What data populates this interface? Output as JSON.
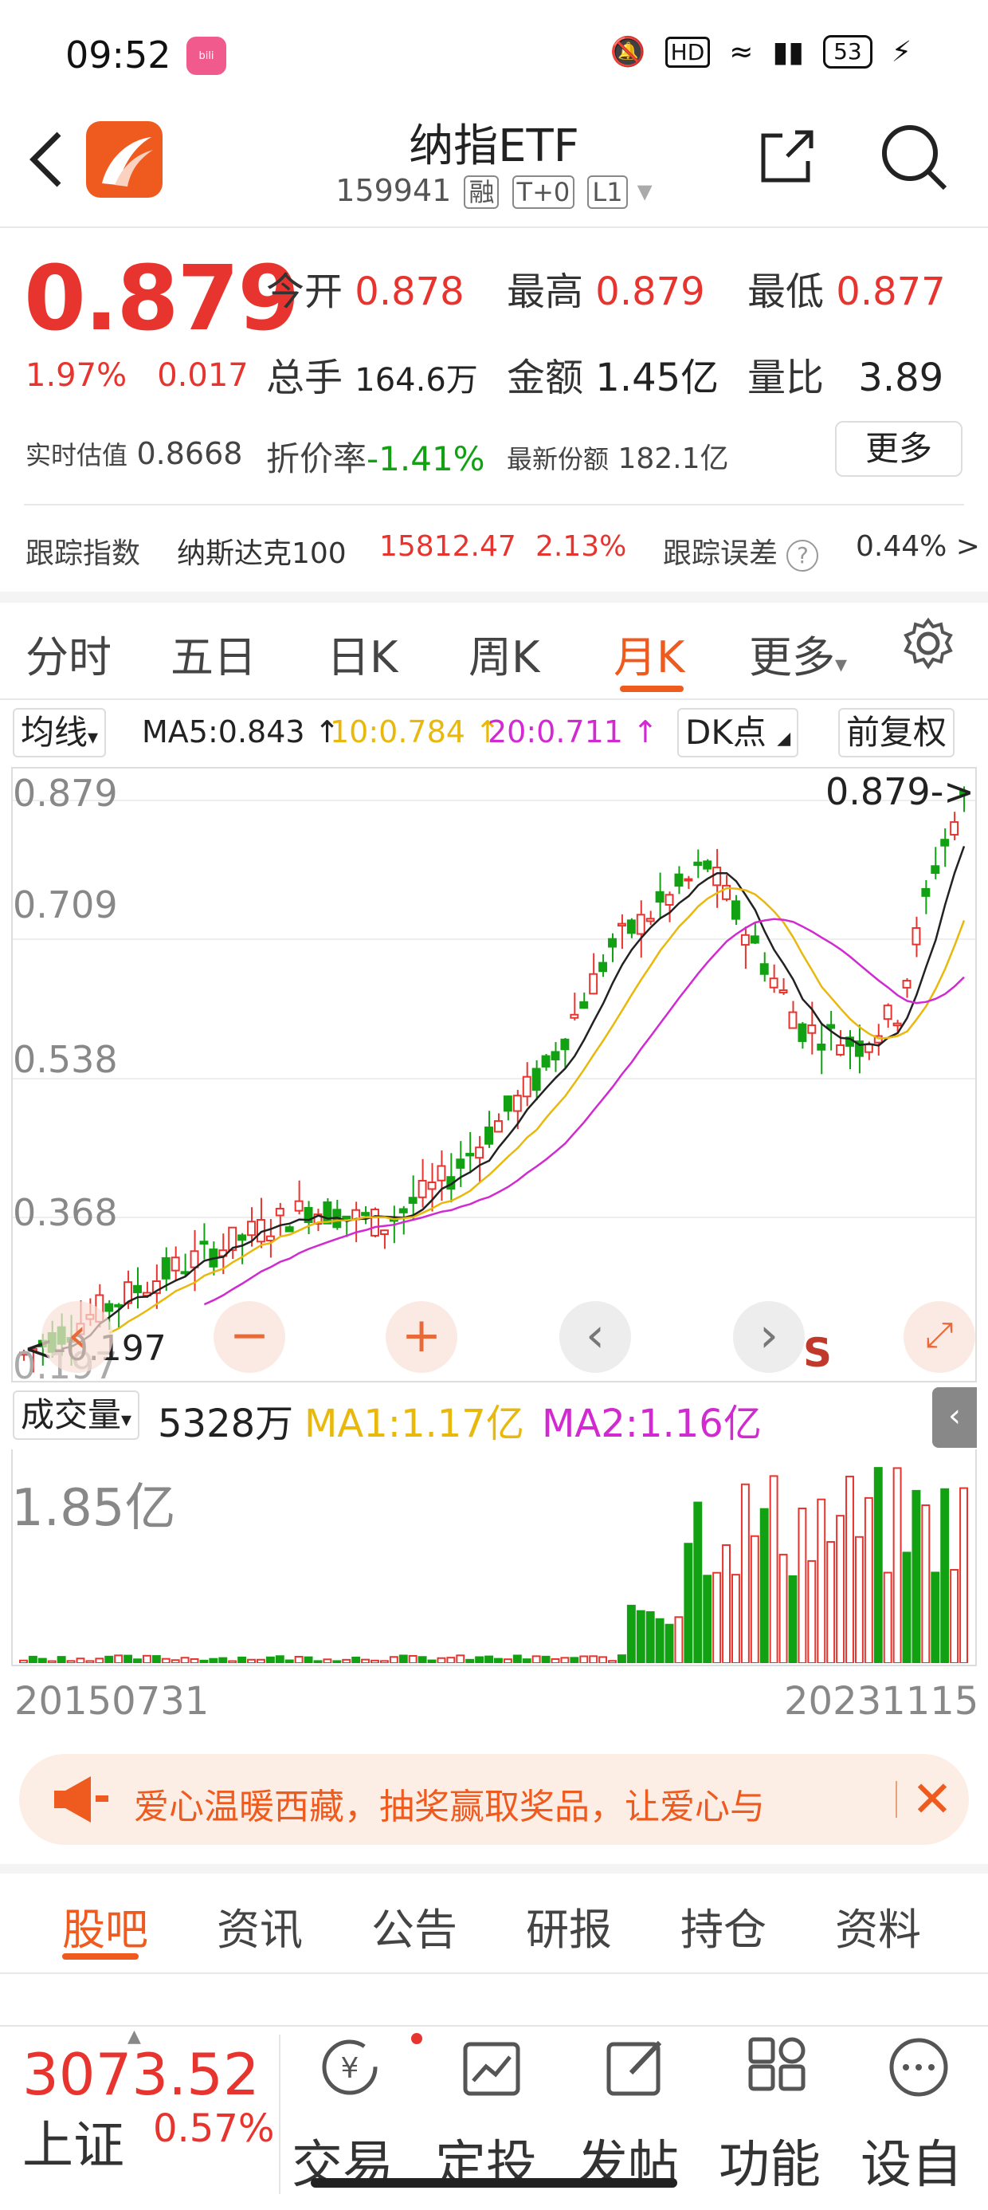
{
  "status": {
    "time": "09:52",
    "battery": "53"
  },
  "header": {
    "title": "纳指ETF",
    "code": "159941",
    "tags": [
      "融",
      "T+0",
      "L1"
    ]
  },
  "quote": {
    "price": "0.879",
    "change_pct": "1.97%",
    "change_amt": "0.017",
    "open_label": "今开",
    "open": "0.878",
    "high_label": "最高",
    "high": "0.879",
    "low_label": "最低",
    "low": "0.877",
    "volume_label": "总手",
    "volume": "164.6万",
    "amount_label": "金额",
    "amount": "1.45亿",
    "ratio_label": "量比",
    "ratio": "3.89",
    "iopv_label": "实时估值",
    "iopv": "0.8668",
    "discount_label": "折价率",
    "discount": "-1.41%",
    "shares_label": "最新份额",
    "shares": "182.1亿",
    "more": "更多"
  },
  "tracking": {
    "label": "跟踪指数",
    "index_name": "纳斯达克100",
    "index_value": "15812.47",
    "index_change": "2.13%",
    "error_label": "跟踪误差",
    "error_value": "0.44% >"
  },
  "tabs": [
    "分时",
    "五日",
    "日K",
    "周K",
    "月K",
    "更多"
  ],
  "chart_toolbar": {
    "ma_select": "均线",
    "ma5": "MA5:0.843",
    "ma10": "10:0.784",
    "ma20": "20:0.711",
    "dk": "DK点",
    "adjust": "前复权"
  },
  "kchart": {
    "y_labels": [
      "0.879",
      "0.709",
      "0.538",
      "0.368",
      "0.197"
    ],
    "last_price_marker": "0.879->",
    "low_marker": "<-0.197",
    "s_marker": "S"
  },
  "volume": {
    "select": "成交量",
    "value": "5328万",
    "ma1": "MA1:1.17亿",
    "ma2": "MA2:1.16亿",
    "y_label": "1.85亿",
    "start_date": "20150731",
    "end_date": "20231115"
  },
  "banner": {
    "text": "爱心温暖西藏，抽奖赢取奖品，让爱心与"
  },
  "bottom_tabs": [
    "股吧",
    "资讯",
    "公告",
    "研报",
    "持仓",
    "资料"
  ],
  "bottom_bar": {
    "index_value": "3073.52",
    "index_name": "上证",
    "index_change": "0.57%",
    "items": [
      "交易",
      "定投",
      "发帖",
      "功能",
      "设自"
    ]
  },
  "colors": {
    "up": "#e8342e",
    "down": "#12a112",
    "accent": "#ef5a1e",
    "ma5": "#222222",
    "ma10": "#e8b90c",
    "ma20": "#d02ad0"
  }
}
